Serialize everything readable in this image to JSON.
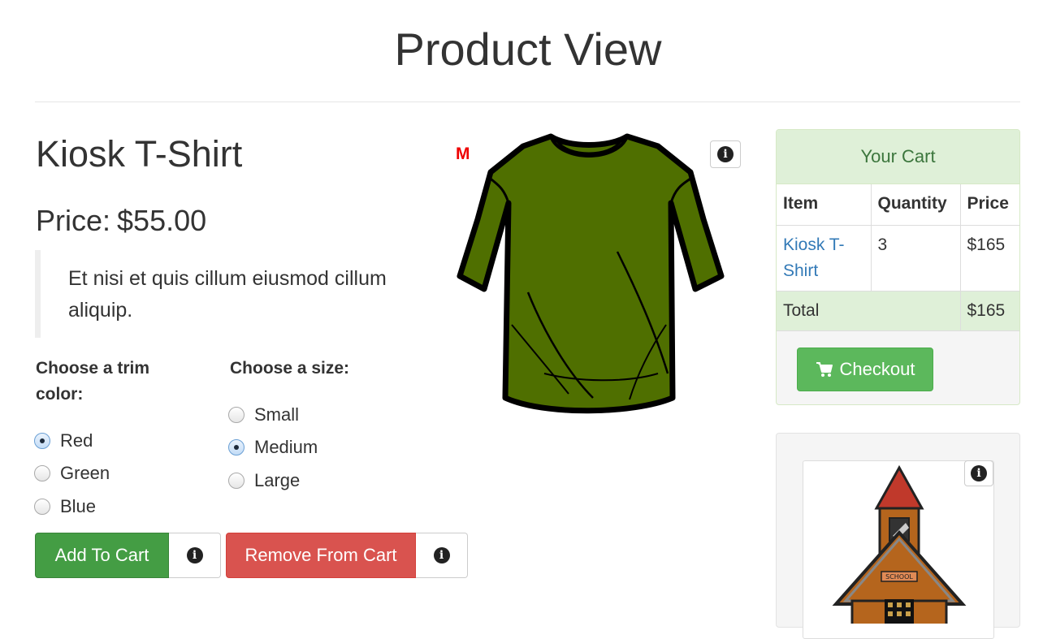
{
  "page": {
    "title": "Product View"
  },
  "product": {
    "name": "Kiosk T-Shirt",
    "price_label": "Price:",
    "price": "$55.00",
    "description": "Et nisi et quis cillum eiusmod cillum aliquip.",
    "size_marker": "M",
    "image_icon": "tshirt-image",
    "shirt_color": "#4f6f00"
  },
  "options": {
    "trim": {
      "title": "Choose a trim color:",
      "items": [
        {
          "label": "Red",
          "checked": true
        },
        {
          "label": "Green",
          "checked": false
        },
        {
          "label": "Blue",
          "checked": false
        }
      ]
    },
    "size": {
      "title": "Choose a size:",
      "items": [
        {
          "label": "Small",
          "checked": false
        },
        {
          "label": "Medium",
          "checked": true
        },
        {
          "label": "Large",
          "checked": false
        }
      ]
    }
  },
  "actions": {
    "add_to_cart": "Add To Cart",
    "remove_from_cart": "Remove From Cart",
    "info_glyph": "i"
  },
  "cart": {
    "heading": "Your Cart",
    "columns": [
      "Item",
      "Quantity",
      "Price"
    ],
    "rows": [
      {
        "item": "Kiosk T-Shirt",
        "quantity": "3",
        "price": "$165"
      }
    ],
    "total_label": "Total",
    "total_value": "$165",
    "checkout_label": "Checkout",
    "checkout_icon": "cart-icon"
  },
  "promo": {
    "image_icon": "schoolhouse-image",
    "sign_text": "SCHOOL"
  },
  "colors": {
    "success": "#449d44",
    "danger": "#d9534f",
    "cart_header_bg": "#dff0d8",
    "cart_header_text": "#3c763d",
    "link": "#337ab7",
    "checkout": "#5cb85c"
  }
}
